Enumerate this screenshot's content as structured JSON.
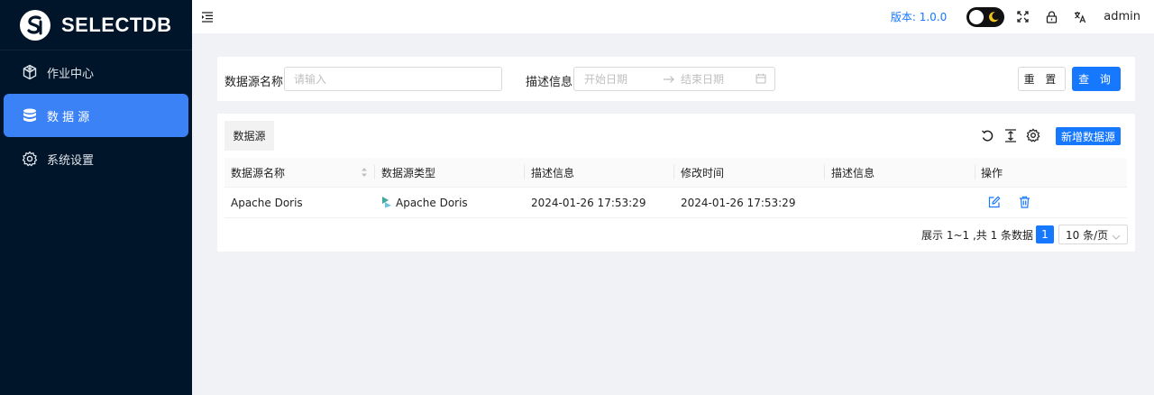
{
  "brand": {
    "name": "SELECTDB"
  },
  "sidebar": {
    "items": [
      {
        "label": "作业中心",
        "icon": "cube-icon",
        "active": false
      },
      {
        "label": "数 据 源",
        "icon": "database-icon",
        "active": true
      },
      {
        "label": "系统设置",
        "icon": "gear-icon",
        "active": false
      }
    ]
  },
  "header": {
    "version": "版本: 1.0.0",
    "user": "admin",
    "icons": [
      "menu-fold-icon",
      "theme-toggle",
      "fullscreen-icon",
      "lock-icon",
      "translate-icon"
    ]
  },
  "search": {
    "name_label": "数据源名称",
    "name_placeholder": "请输入",
    "desc_label": "描述信息",
    "start_placeholder": "开始日期",
    "end_placeholder": "结束日期",
    "reset_label": "重 置",
    "query_label": "查 询"
  },
  "table": {
    "tab_label": "数据源",
    "add_label": "新增数据源",
    "columns": [
      "数据源名称",
      "数据源类型",
      "描述信息",
      "修改时间",
      "描述信息",
      "操作"
    ],
    "rows": [
      {
        "name": "Apache Doris",
        "type": "Apache Doris",
        "desc": "2024-01-26 17:53:29",
        "modified": "2024-01-26 17:53:29",
        "desc2": ""
      }
    ],
    "pagination": {
      "summary": "展示 1~1 ,共 1 条数据",
      "current_page": "1",
      "page_size": "10 条/页"
    }
  },
  "colors": {
    "sidebar_bg": "#001529",
    "accent": "#1677ff",
    "active_nav": "#3b82f6"
  }
}
